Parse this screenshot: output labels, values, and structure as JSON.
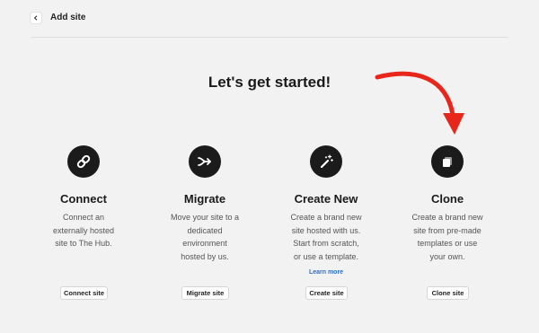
{
  "header": {
    "back_icon": "chevron-left-icon",
    "title": "Add site"
  },
  "hero": {
    "title": "Let's get started!"
  },
  "annotation": {
    "arrow_color": "#e8261c"
  },
  "cards": [
    {
      "icon": "link-icon",
      "title": "Connect",
      "description": "Connect an\nexternally hosted\nsite to The Hub.",
      "button": "Connect site"
    },
    {
      "icon": "migrate-icon",
      "title": "Migrate",
      "description": "Move your site to a\ndedicated\nenvironment\nhosted by us.",
      "button": "Migrate site"
    },
    {
      "icon": "magic-wand-icon",
      "title": "Create New",
      "description": "Create a brand new\nsite hosted with us.\nStart from scratch,\nor use a template.",
      "link": "Learn more",
      "button": "Create site"
    },
    {
      "icon": "copy-icon",
      "title": "Clone",
      "description": "Create a brand new\nsite from pre-made\ntemplates or use\nyour own.",
      "button": "Clone site"
    }
  ]
}
